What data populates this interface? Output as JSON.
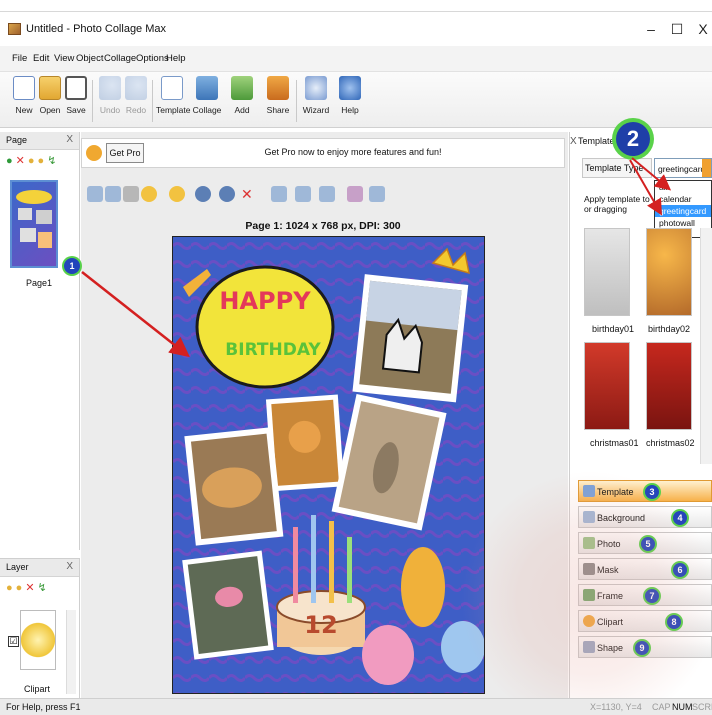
{
  "window": {
    "title": "Untitled - Photo Collage Max",
    "minimize": "–",
    "maximize": "☐",
    "close": "X"
  },
  "menu": [
    "File",
    "Edit",
    "View",
    "Object",
    "Collage",
    "Options",
    "Help"
  ],
  "toolbar": [
    {
      "label": "New",
      "icon": "new-doc-icon",
      "enabled": true
    },
    {
      "label": "Open",
      "icon": "folder-icon",
      "enabled": true
    },
    {
      "label": "Save",
      "icon": "save-icon",
      "enabled": true
    },
    {
      "label": "Undo",
      "icon": "undo-icon",
      "enabled": false
    },
    {
      "label": "Redo",
      "icon": "redo-icon",
      "enabled": false
    },
    {
      "label": "Template",
      "icon": "template-icon",
      "enabled": true
    },
    {
      "label": "Collage",
      "icon": "collage-icon",
      "enabled": true
    },
    {
      "label": "Add",
      "icon": "add-icon",
      "enabled": true
    },
    {
      "label": "Share",
      "icon": "share-icon",
      "enabled": true
    },
    {
      "label": "Wizard",
      "icon": "wizard-icon",
      "enabled": true
    },
    {
      "label": "Help",
      "icon": "help-icon",
      "enabled": true
    }
  ],
  "page_panel": {
    "title": "Page",
    "close": "X",
    "thumb_label": "Page1"
  },
  "layer_panel": {
    "title": "Layer",
    "close": "X",
    "item_label": "Clipart",
    "checked": "☑"
  },
  "promo": {
    "button": "Get Pro",
    "text": "Get Pro now to enjoy more features and fun!"
  },
  "page_info": "Page 1: 1024 x 768 px, DPI: 300",
  "template_panel": {
    "title": "Template",
    "close": "X",
    "type_label": "Template Type",
    "selected": "greetingcard",
    "options": [
      "all",
      "calendar",
      "greetingcard",
      "photowall"
    ],
    "hint": "Apply template to or dragging",
    "thumbs": [
      "birthday01",
      "birthday02",
      "christmas01",
      "christmas02"
    ]
  },
  "tabs": [
    {
      "label": "Template",
      "badge": "3",
      "active": true,
      "icon": "template-tab-icon"
    },
    {
      "label": "Background",
      "badge": "4",
      "active": false,
      "icon": "background-tab-icon"
    },
    {
      "label": "Photo",
      "badge": "5",
      "active": false,
      "icon": "photo-tab-icon"
    },
    {
      "label": "Mask",
      "badge": "6",
      "active": false,
      "icon": "mask-tab-icon"
    },
    {
      "label": "Frame",
      "badge": "7",
      "active": false,
      "icon": "frame-tab-icon"
    },
    {
      "label": "Clipart",
      "badge": "8",
      "active": false,
      "icon": "clipart-tab-icon"
    },
    {
      "label": "Shape",
      "badge": "9",
      "active": false,
      "icon": "shape-tab-icon"
    }
  ],
  "callouts": {
    "one": "1",
    "two": "2"
  },
  "canvas_text": {
    "happy": "HAPPY",
    "birthday": "BIRTHDAY",
    "cake_number": "12"
  },
  "statusbar": {
    "left": "For Help, press F1",
    "coords": "X=1130, Y=4",
    "cap": "CAP",
    "num": "NUM",
    "scrl": "SCRL"
  },
  "colors": {
    "accent_tab": "#f7b14a",
    "badge": "#2244bb",
    "badge_ring": "#58d14a",
    "arrow": "#d42020",
    "canvas_bg": "#3d5fc8"
  }
}
